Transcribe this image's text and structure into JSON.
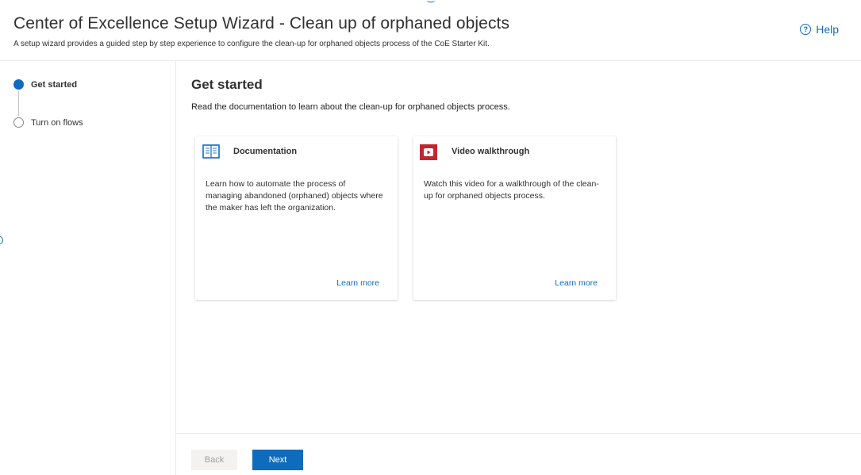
{
  "header": {
    "title": "Center of Excellence Setup Wizard - Clean up of orphaned objects",
    "subtitle": "A setup wizard provides a guided step by step experience to configure the clean-up for orphaned objects process of the CoE Starter Kit.",
    "help_label": "Help",
    "help_icon": "question-circle-icon"
  },
  "steps": [
    {
      "label": "Get started",
      "active": true
    },
    {
      "label": "Turn on flows",
      "active": false
    }
  ],
  "main": {
    "title": "Get started",
    "description": "Read the documentation to learn about the clean-up for orphaned objects process.",
    "cards": [
      {
        "icon": "book-icon",
        "title": "Documentation",
        "text": "Learn how to automate the process of managing abandoned (orphaned) objects where the maker has left the organization.",
        "link": "Learn more"
      },
      {
        "icon": "youtube-icon",
        "title": "Video walkthrough",
        "text": "Watch this video for a walkthrough of the clean-up for orphaned objects process.",
        "link": "Learn more"
      }
    ]
  },
  "footer": {
    "back_label": "Back",
    "next_label": "Next"
  },
  "colors": {
    "accent": "#0f6cbd",
    "youtube": "#c4262e"
  }
}
